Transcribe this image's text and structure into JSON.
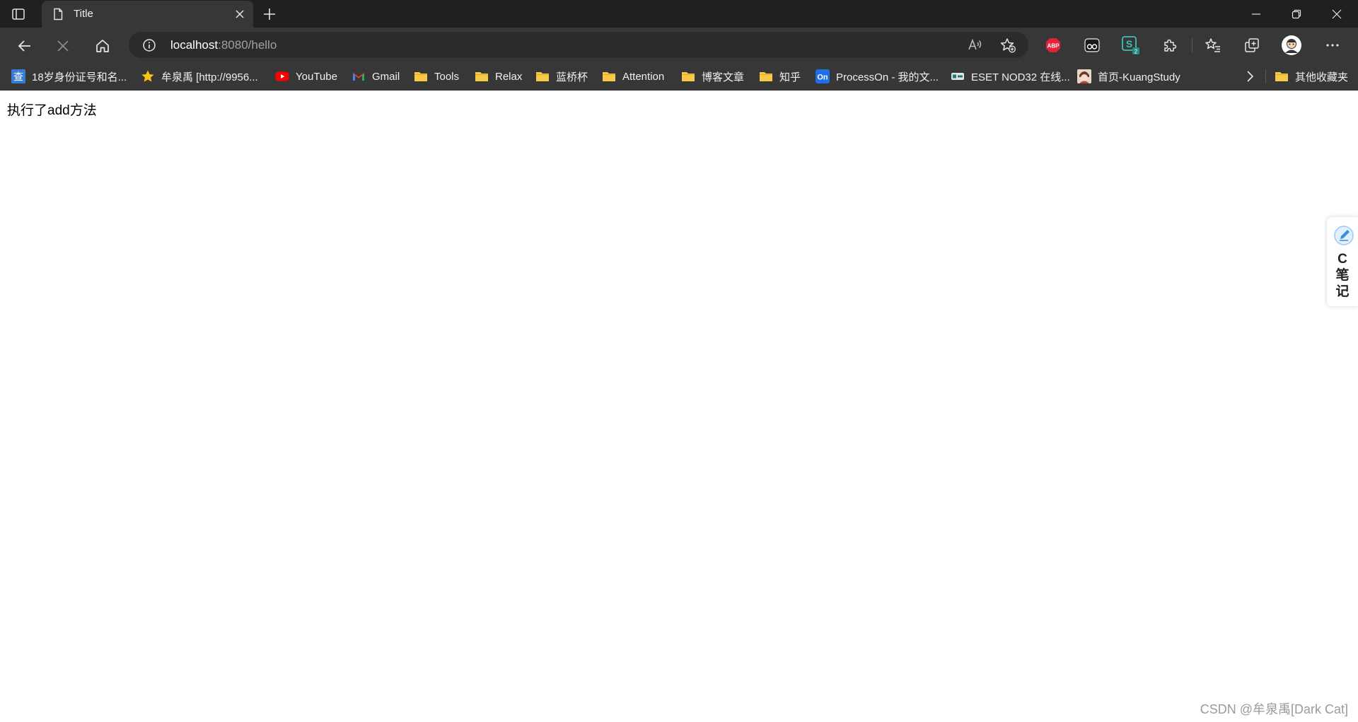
{
  "tab": {
    "title": "Title"
  },
  "address": {
    "host": "localhost",
    "rest": ":8080/hello"
  },
  "extensions": {
    "abp_label": "ABP",
    "s_badge": "2"
  },
  "bookmarks": [
    {
      "label": "18岁身份证号和名...",
      "icon": "cha-icon"
    },
    {
      "label": "牟泉禹 [http://9956...",
      "icon": "star-icon"
    },
    {
      "label": "YouTube",
      "icon": "youtube-icon"
    },
    {
      "label": "Gmail",
      "icon": "gmail-icon"
    },
    {
      "label": "Tools",
      "icon": "folder-icon"
    },
    {
      "label": "Relax",
      "icon": "folder-icon"
    },
    {
      "label": "蓝桥杯",
      "icon": "folder-icon"
    },
    {
      "label": "Attention",
      "icon": "folder-icon"
    },
    {
      "label": "博客文章",
      "icon": "folder-icon"
    },
    {
      "label": "知乎",
      "icon": "folder-icon"
    },
    {
      "label": "ProcessOn - 我的文...",
      "icon": "processon-icon"
    },
    {
      "label": "ESET NOD32 在线...",
      "icon": "eset-icon"
    },
    {
      "label": "首页-KuangStudy",
      "icon": "kuangstudy-icon"
    }
  ],
  "bookmark_icon_text": {
    "cha": "查",
    "on": "On"
  },
  "other_bookmarks": {
    "label": "其他收藏夹"
  },
  "page": {
    "text": "执行了add方法"
  },
  "side_widget": {
    "text": "C笔记"
  },
  "watermark": {
    "text": "CSDN @牟泉禹[Dark Cat]"
  },
  "colors": {
    "tabstrip": "#202020",
    "toolbar": "#373737",
    "addressbar": "#2b2b2b",
    "folder": "#f7c948",
    "abp": "#e3223b",
    "youtube": "#ff0000",
    "page_background": "#ffffff"
  }
}
